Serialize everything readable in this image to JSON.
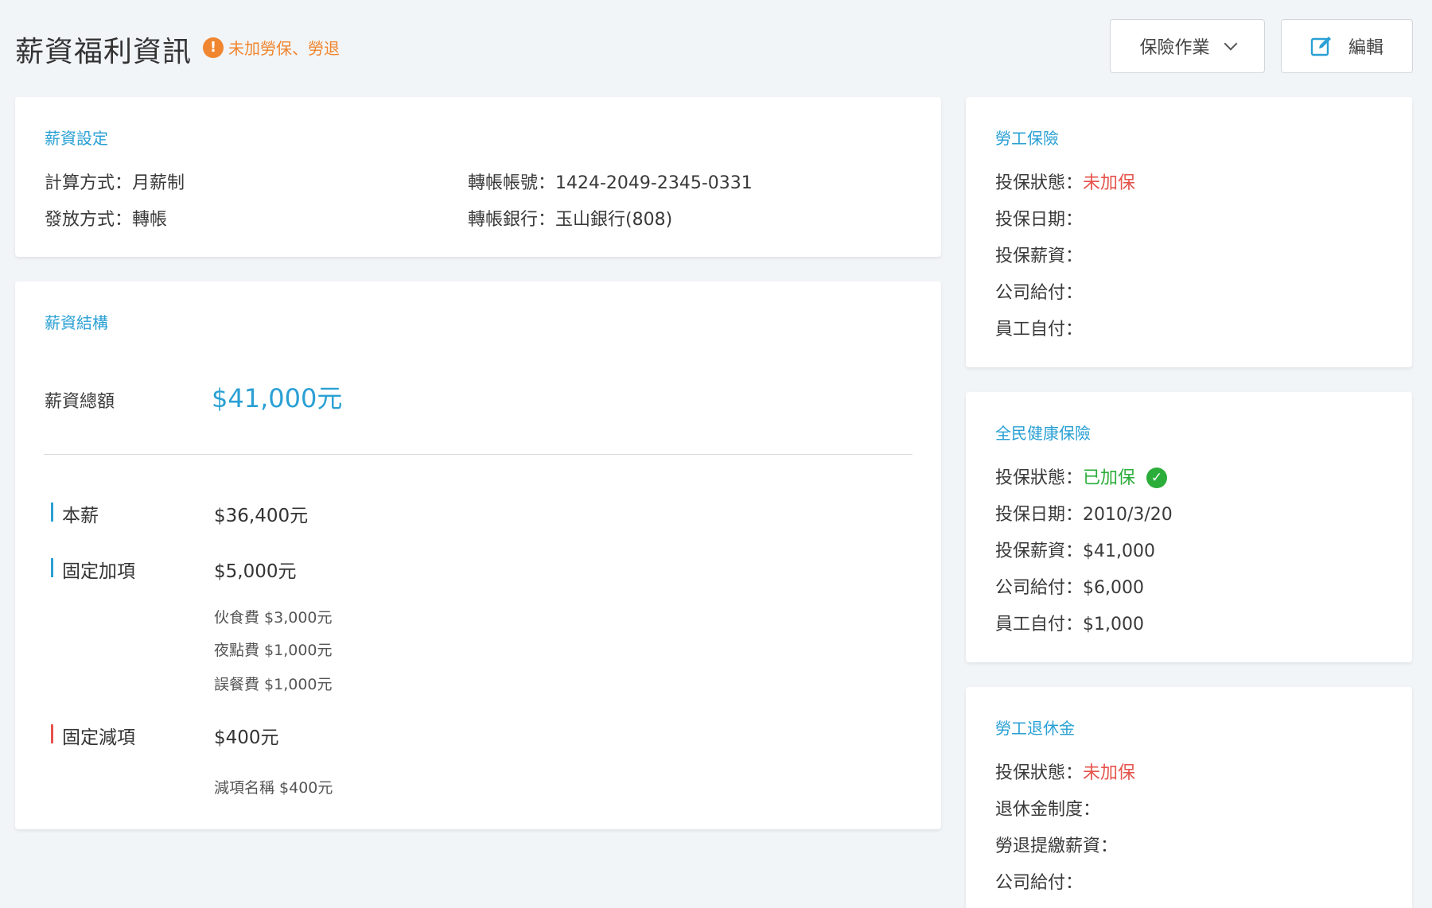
{
  "header": {
    "title": "薪資福利資訊",
    "warning": "未加勞保、勞退",
    "insurance_button": "保險作業",
    "edit_button": "編輯"
  },
  "salary_settings": {
    "title": "薪資設定",
    "calc_method": "計算方式：月薪制",
    "pay_method": "發放方式：轉帳",
    "account": "轉帳帳號：1424-2049-2345-0331",
    "bank": "轉帳銀行：玉山銀行(808)"
  },
  "salary_structure": {
    "title": "薪資結構",
    "total_label": "薪資總額",
    "total_value": "$41,000元",
    "base_label": "本薪",
    "base_value": "$36,400元",
    "additions_label": "固定加項",
    "additions_value": "$5,000元",
    "additions_items": [
      "伙食費  $3,000元",
      "夜點費  $1,000元",
      "誤餐費  $1,000元"
    ],
    "deductions_label": "固定減項",
    "deductions_value": "$400元",
    "deductions_items": [
      "減項名稱  $400元"
    ]
  },
  "labor_insurance": {
    "title": "勞工保險",
    "status_label": "投保狀態：",
    "status_value": "未加保",
    "date": "投保日期：",
    "salary": "投保薪資：",
    "company": "公司給付：",
    "employee": "員工自付："
  },
  "health_insurance": {
    "title": "全民健康保險",
    "status_label": "投保狀態：",
    "status_value": "已加保",
    "date": "投保日期：2010/3/20",
    "salary": "投保薪資：$41,000",
    "company": "公司給付：$6,000",
    "employee": "員工自付：$1,000"
  },
  "pension": {
    "title": "勞工退休金",
    "status_label": "投保狀態：",
    "status_value": "未加保",
    "system": "退休金制度：",
    "contribution": "勞退提繳薪資：",
    "company": "公司給付："
  },
  "colors": {
    "accent": "#2aa0d4",
    "warning": "#f0862f",
    "danger": "#e5534b",
    "success": "#2bad3a"
  }
}
